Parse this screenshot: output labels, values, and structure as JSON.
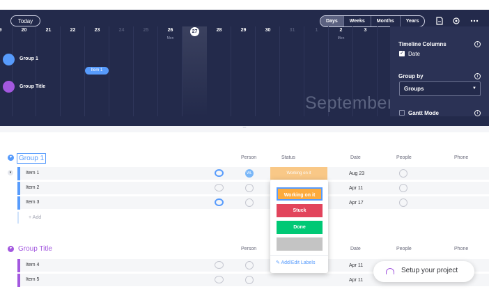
{
  "toolbar": {
    "today_label": "Today",
    "view_modes": [
      "Days",
      "Weeks",
      "Months",
      "Years"
    ],
    "active_view": "Days",
    "icons": [
      "export-icon",
      "settings-icon",
      "more-icon"
    ]
  },
  "timeline": {
    "day_numbers": [
      "9",
      "20",
      "21",
      "22",
      "23",
      "24",
      "25",
      "26",
      "27",
      "28",
      "29",
      "30",
      "31",
      "1",
      "2",
      "3"
    ],
    "dimmed_days": [
      "24",
      "25",
      "31",
      "1"
    ],
    "month_markers": [
      "Mon",
      "Mon"
    ],
    "today": "27",
    "groups": [
      {
        "name": "Group 1",
        "color": "#579bfc"
      },
      {
        "name": "Group Title",
        "color": "#a358df"
      }
    ],
    "item_pill": "Item 1",
    "month_label": "September"
  },
  "settings_panel": {
    "timeline_columns_title": "Timeline Columns",
    "date_option": "Date",
    "date_checked": true,
    "group_by_title": "Group by",
    "group_by_value": "Groups",
    "gantt_mode_label": "Gantt Mode",
    "gantt_checked": false
  },
  "board": {
    "columns": [
      "Person",
      "Status",
      "Date",
      "People",
      "Phone"
    ],
    "groups": [
      {
        "name": "Group 1",
        "color": "#579bfc",
        "items": [
          {
            "name": "Item 1",
            "date": "Aug 23",
            "status": "Working on it",
            "person": "WL"
          },
          {
            "name": "Item 2",
            "date": "Apr 11"
          },
          {
            "name": "Item 3",
            "date": "Apr 17"
          }
        ],
        "add_label": "+ Add"
      },
      {
        "name": "Group Title",
        "color": "#a358df",
        "items": [
          {
            "name": "Item 4",
            "date": "Apr 11"
          },
          {
            "name": "Item 5",
            "date": "Apr 11"
          }
        ]
      }
    ]
  },
  "status_popup": {
    "labels": [
      {
        "text": "Working on it",
        "color": "#fdab3d"
      },
      {
        "text": "Stuck",
        "color": "#e2445c"
      },
      {
        "text": "Done",
        "color": "#00c875"
      },
      {
        "text": "",
        "color": "#c4c4c4"
      }
    ],
    "edit_link": "Add/Edit Labels"
  },
  "setup_button": {
    "label": "Setup your project"
  }
}
